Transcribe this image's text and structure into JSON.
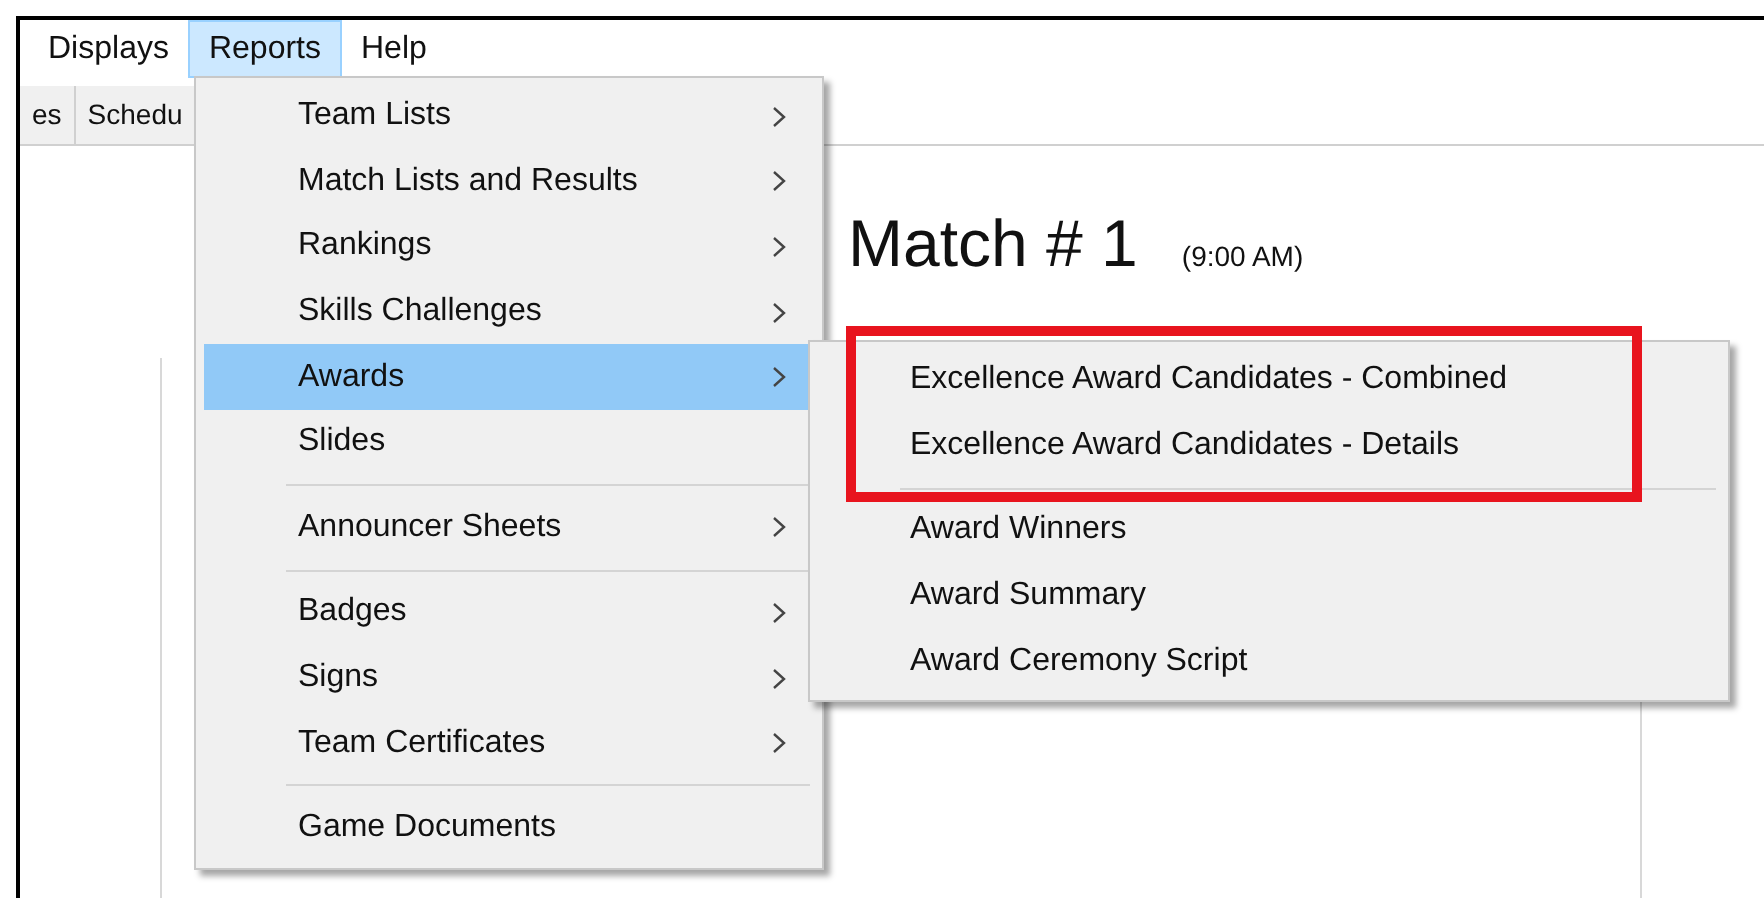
{
  "menu_bar": [
    {
      "label": "Displays",
      "selected": false
    },
    {
      "label": "Reports",
      "selected": true
    },
    {
      "label": "Help",
      "selected": false
    }
  ],
  "tabs": [
    {
      "label": "es"
    },
    {
      "label": "Schedu"
    }
  ],
  "match": {
    "title": "Match # 1",
    "time": "(9:00 AM)"
  },
  "menu": {
    "groups": [
      {
        "items": [
          {
            "label": "Team Lists",
            "submenu": true,
            "selected": false
          },
          {
            "label": "Match Lists and Results",
            "submenu": true,
            "selected": false
          },
          {
            "label": "Rankings",
            "submenu": true,
            "selected": false
          },
          {
            "label": "Skills Challenges",
            "submenu": true,
            "selected": false
          },
          {
            "label": "Awards",
            "submenu": true,
            "selected": true
          },
          {
            "label": "Slides",
            "submenu": false,
            "selected": false
          }
        ]
      },
      {
        "items": [
          {
            "label": "Announcer Sheets",
            "submenu": true,
            "selected": false
          }
        ]
      },
      {
        "items": [
          {
            "label": "Badges",
            "submenu": true,
            "selected": false
          },
          {
            "label": "Signs",
            "submenu": true,
            "selected": false
          },
          {
            "label": "Team Certificates",
            "submenu": true,
            "selected": false
          }
        ]
      },
      {
        "items": [
          {
            "label": "Game Documents",
            "submenu": false,
            "selected": false
          }
        ]
      }
    ]
  },
  "submenu": {
    "groups": [
      {
        "outlined": true,
        "items": [
          "Excellence Award Candidates - Combined",
          "Excellence Award Candidates - Details"
        ]
      },
      {
        "outlined": false,
        "items": [
          "Award Winners",
          "Award Summary",
          "Award Ceremony Script"
        ]
      }
    ]
  }
}
